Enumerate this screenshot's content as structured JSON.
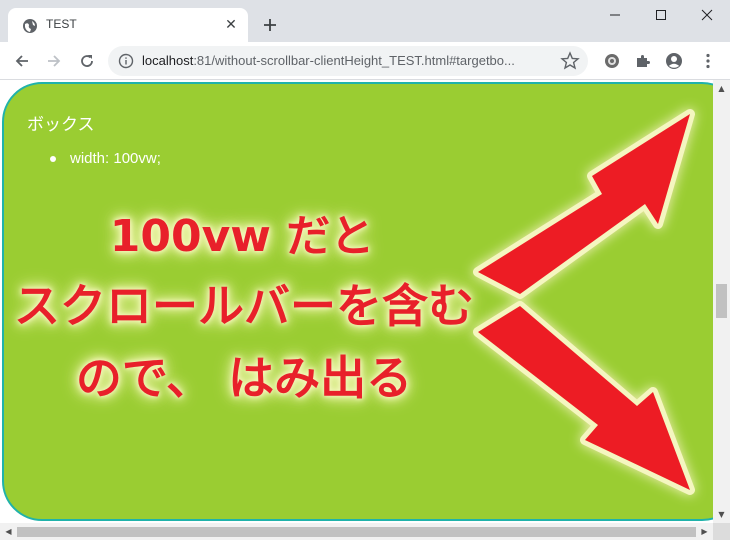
{
  "browser": {
    "tab_title": "TEST",
    "url_host": "localhost",
    "url_rest": ":81/without-scrollbar-clientHeight_TEST.html#targetbo..."
  },
  "page": {
    "heading": "ボックス",
    "list_items": [
      "width: 100vw;"
    ],
    "annotation": {
      "line1": "100vw だと",
      "line2": "スクロールバーを含む",
      "line3": "ので、 はみ出る"
    }
  },
  "colors": {
    "box_background": "#9acd32",
    "box_border": "#20b2aa",
    "annotation_text": "#e8202a",
    "arrow": "#ed1c24"
  },
  "icons": [
    "globe-icon",
    "close-icon",
    "plus-icon",
    "minimize-icon",
    "maximize-icon",
    "window-close-icon",
    "back-arrow-icon",
    "forward-arrow-icon",
    "reload-icon",
    "info-icon",
    "star-icon",
    "extension-gear-icon",
    "puzzle-icon",
    "profile-icon",
    "more-icon"
  ]
}
